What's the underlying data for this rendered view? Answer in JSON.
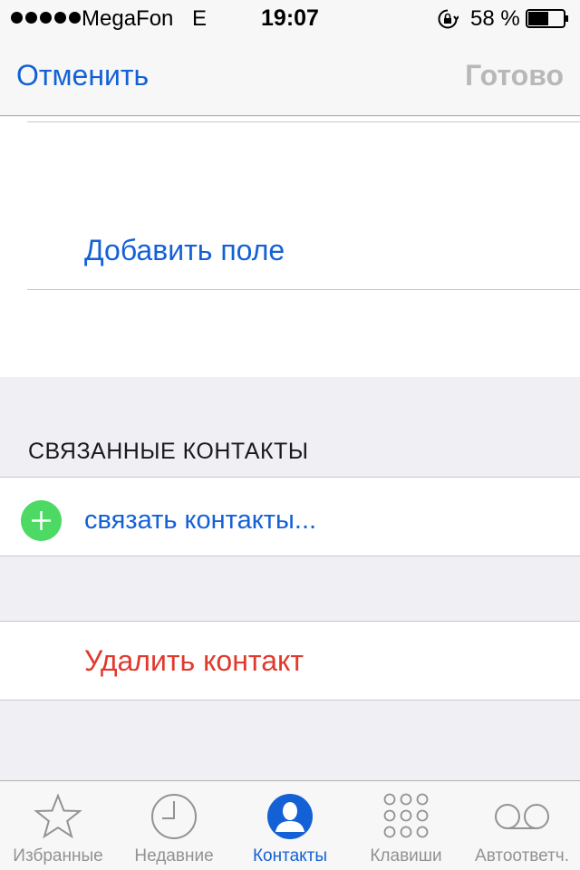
{
  "status_bar": {
    "carrier": "MegaFon",
    "network": "E",
    "time": "19:07",
    "battery_percent": "58 %",
    "battery_level": 0.58,
    "signal_bars": 5
  },
  "nav": {
    "cancel_label": "Отменить",
    "done_label": "Готово"
  },
  "content": {
    "add_field_label": "Добавить поле",
    "linked_header": "СВЯЗАННЫЕ КОНТАКТЫ",
    "link_contacts_label": "связать контакты...",
    "delete_contact_label": "Удалить контакт"
  },
  "tabs": [
    {
      "label": "Избранные",
      "icon": "star-icon",
      "active": false
    },
    {
      "label": "Недавние",
      "icon": "clock-icon",
      "active": false
    },
    {
      "label": "Контакты",
      "icon": "person-icon",
      "active": true
    },
    {
      "label": "Клавиши",
      "icon": "keypad-icon",
      "active": false
    },
    {
      "label": "Автоответч.",
      "icon": "voicemail-icon",
      "active": false
    }
  ],
  "colors": {
    "accent": "#1461d6",
    "destructive": "#e0392d",
    "add": "#4cd964",
    "disabled": "#b8b8b8"
  }
}
